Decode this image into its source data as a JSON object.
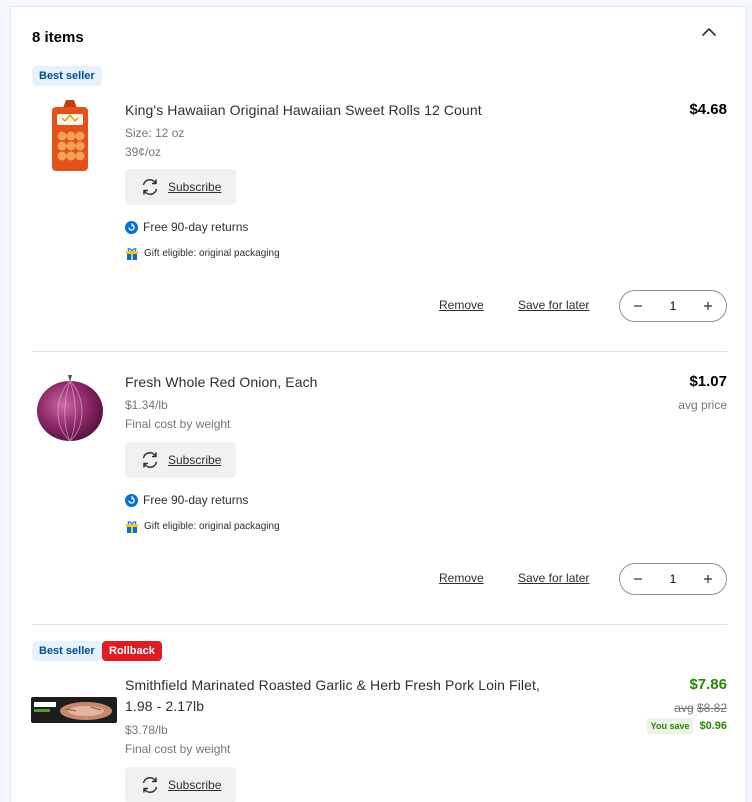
{
  "cart": {
    "count_label": "8 items"
  },
  "items": [
    {
      "badges": [
        "Best seller"
      ],
      "name": "King's Hawaiian Original Hawaiian Sweet Rolls 12 Count",
      "size": "Size: 12 oz",
      "unit_price": "39¢/oz",
      "price": "$4.68",
      "subscribe_label": "Subscribe",
      "returns_label": "Free 90-day returns",
      "gift_label": "Gift eligible: original packaging",
      "remove_label": "Remove",
      "save_label": "Save for later",
      "quantity": "1"
    },
    {
      "name": "Fresh Whole Red Onion, Each",
      "unit_price": "$1.34/lb",
      "cost_note": "Final cost by weight",
      "price": "$1.07",
      "price_note": "avg price",
      "subscribe_label": "Subscribe",
      "returns_label": "Free 90-day returns",
      "gift_label": "Gift eligible: original packaging",
      "remove_label": "Remove",
      "save_label": "Save for later",
      "quantity": "1"
    },
    {
      "badges": [
        "Best seller",
        "Rollback"
      ],
      "name_line1": "Smithfield Marinated Roasted Garlic & Herb Fresh Pork Loin Filet,",
      "name_line2": "1.98 - 2.17lb",
      "unit_price": "$3.78/lb",
      "cost_note": "Final cost by weight",
      "price": "$7.86",
      "was_prefix": "avg",
      "was_price": "$8.82",
      "you_save_label": "You save",
      "you_save_amount": "$0.96",
      "subscribe_label": "Subscribe"
    }
  ],
  "colors": {
    "accent_blue": "#0071dc",
    "rollback_red": "#de1c24",
    "savings_green": "#2a8703"
  }
}
